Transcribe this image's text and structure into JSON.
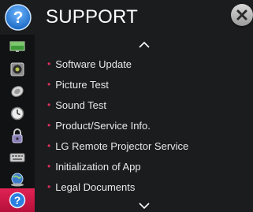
{
  "header": {
    "title": "SUPPORT",
    "help_icon": "question-mark-icon",
    "close_icon": "close-icon"
  },
  "sidebar": {
    "items": [
      {
        "name": "picture-settings",
        "icon": "monitor-icon",
        "active": false
      },
      {
        "name": "sound-settings",
        "icon": "speaker-icon",
        "active": false
      },
      {
        "name": "channel-settings",
        "icon": "satellite-dish-icon",
        "active": false
      },
      {
        "name": "time-settings",
        "icon": "clock-icon",
        "active": false
      },
      {
        "name": "lock-settings",
        "icon": "lock-icon",
        "active": false
      },
      {
        "name": "option-settings",
        "icon": "keyboard-icon",
        "active": false
      },
      {
        "name": "network-settings",
        "icon": "globe-icon",
        "active": false
      },
      {
        "name": "support",
        "icon": "question-mark-icon",
        "active": true
      }
    ]
  },
  "menu": {
    "items": [
      {
        "label": "Software Update"
      },
      {
        "label": "Picture Test"
      },
      {
        "label": "Sound Test"
      },
      {
        "label": "Product/Service Info."
      },
      {
        "label": "LG Remote Projector Service"
      },
      {
        "label": "Initialization of App"
      },
      {
        "label": "Legal Documents"
      }
    ],
    "scroll_up_icon": "chevron-up-icon",
    "scroll_down_icon": "chevron-down-icon"
  },
  "colors": {
    "background": "#1b1c1e",
    "sidebar": "#111214",
    "accent": "#d8194a",
    "bullet": "#e0305d",
    "text": "#e8e8e8"
  }
}
